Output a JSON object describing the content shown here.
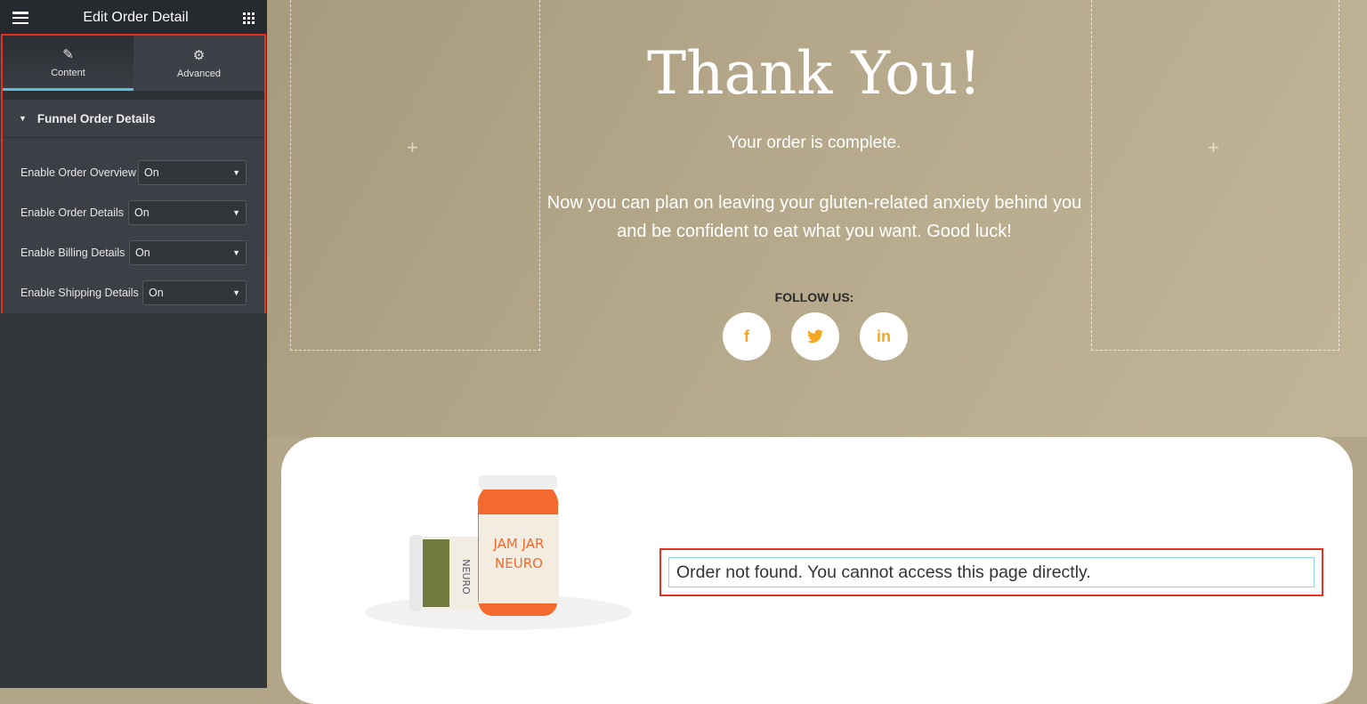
{
  "sidebar": {
    "title": "Edit Order Detail",
    "tabs": [
      {
        "label": "Content",
        "icon": "pencil-icon"
      },
      {
        "label": "Advanced",
        "icon": "gear-icon"
      }
    ],
    "section": "Funnel Order Details",
    "controls": [
      {
        "label": "Enable Order Overview",
        "value": "On"
      },
      {
        "label": "Enable Order Details",
        "value": "On"
      },
      {
        "label": "Enable Billing Details",
        "value": "On"
      },
      {
        "label": "Enable Shipping Details",
        "value": "On"
      }
    ]
  },
  "hero": {
    "title": "Thank You!",
    "subtitle": "Your order is complete.",
    "message": "Now you can plan on leaving your gluten-related anxiety behind you and be confident to eat what you want. Good luck!",
    "follow": "FOLLOW US:",
    "social": [
      {
        "name": "facebook",
        "glyph": "f"
      },
      {
        "name": "twitter",
        "glyph": "t"
      },
      {
        "name": "linkedin",
        "glyph": "in"
      }
    ]
  },
  "product_image": {
    "jar_label_1": "JAM JAR",
    "jar_label_2": "NEURO",
    "jar_label_3": "NEURO"
  },
  "order": {
    "message": "Order not found. You cannot access this page directly."
  },
  "colors": {
    "accent": "#5bc0de",
    "highlight": "#e8301c",
    "social": "#f5a623"
  }
}
